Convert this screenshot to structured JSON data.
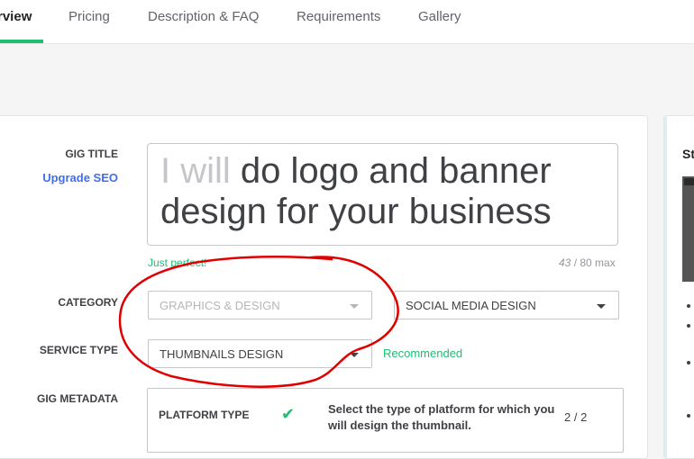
{
  "nav": {
    "tabs": [
      {
        "label": "rview",
        "active": true
      },
      {
        "label": "Pricing"
      },
      {
        "label": "Description & FAQ"
      },
      {
        "label": "Requirements"
      },
      {
        "label": "Gallery"
      }
    ]
  },
  "form": {
    "gig_title_label": "GIG TITLE",
    "upgrade_seo_link": "Upgrade SEO",
    "title_prefix": "I will",
    "title_value": "do logo and banner design for your business",
    "title_feedback": "Just perfect!",
    "title_count": "43",
    "title_max": " / 80 max",
    "category_label": "CATEGORY",
    "category_value": "GRAPHICS & DESIGN",
    "subcategory_value": "SOCIAL MEDIA DESIGN",
    "service_type_label": "SERVICE TYPE",
    "service_type_value": "THUMBNAILS DESIGN",
    "service_type_hint": "Recommended",
    "metadata_label": "GIG METADATA",
    "metadata": {
      "row_label": "PLATFORM TYPE",
      "check_icon": "✔",
      "description": "Select the type of platform for which you will design the thumbnail.",
      "count": "2 / 2"
    }
  },
  "side_panel": {
    "title": "St"
  },
  "colors": {
    "accent": "#1dbf73",
    "link": "#446ee7",
    "annotation": "#e00000"
  }
}
